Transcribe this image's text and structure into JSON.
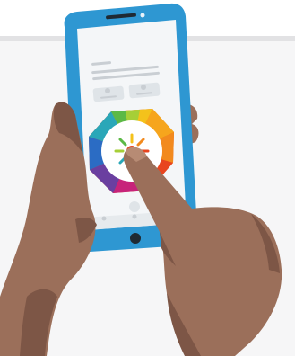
{
  "illustration": {
    "subject": "hands-holding-smartphone-tapping-color-wheel",
    "colors": {
      "phone_body": "#2e97d2",
      "phone_screen": "#f4f6f8",
      "skin": "#9b6f5a",
      "skin_shadow": "#7d5646",
      "placeholder_block": "#dfe4e8",
      "placeholder_line": "#c9ced3",
      "backdrop": "#f6f6f7"
    },
    "wheel_colors": [
      "#f4c21b",
      "#f28a1e",
      "#e8451f",
      "#c7237a",
      "#6a3fa0",
      "#2b6cc4",
      "#2aa7b8",
      "#5cb946",
      "#a6cf37"
    ],
    "icons": [
      "phone-icon",
      "color-wheel-icon",
      "home-button-icon"
    ]
  }
}
